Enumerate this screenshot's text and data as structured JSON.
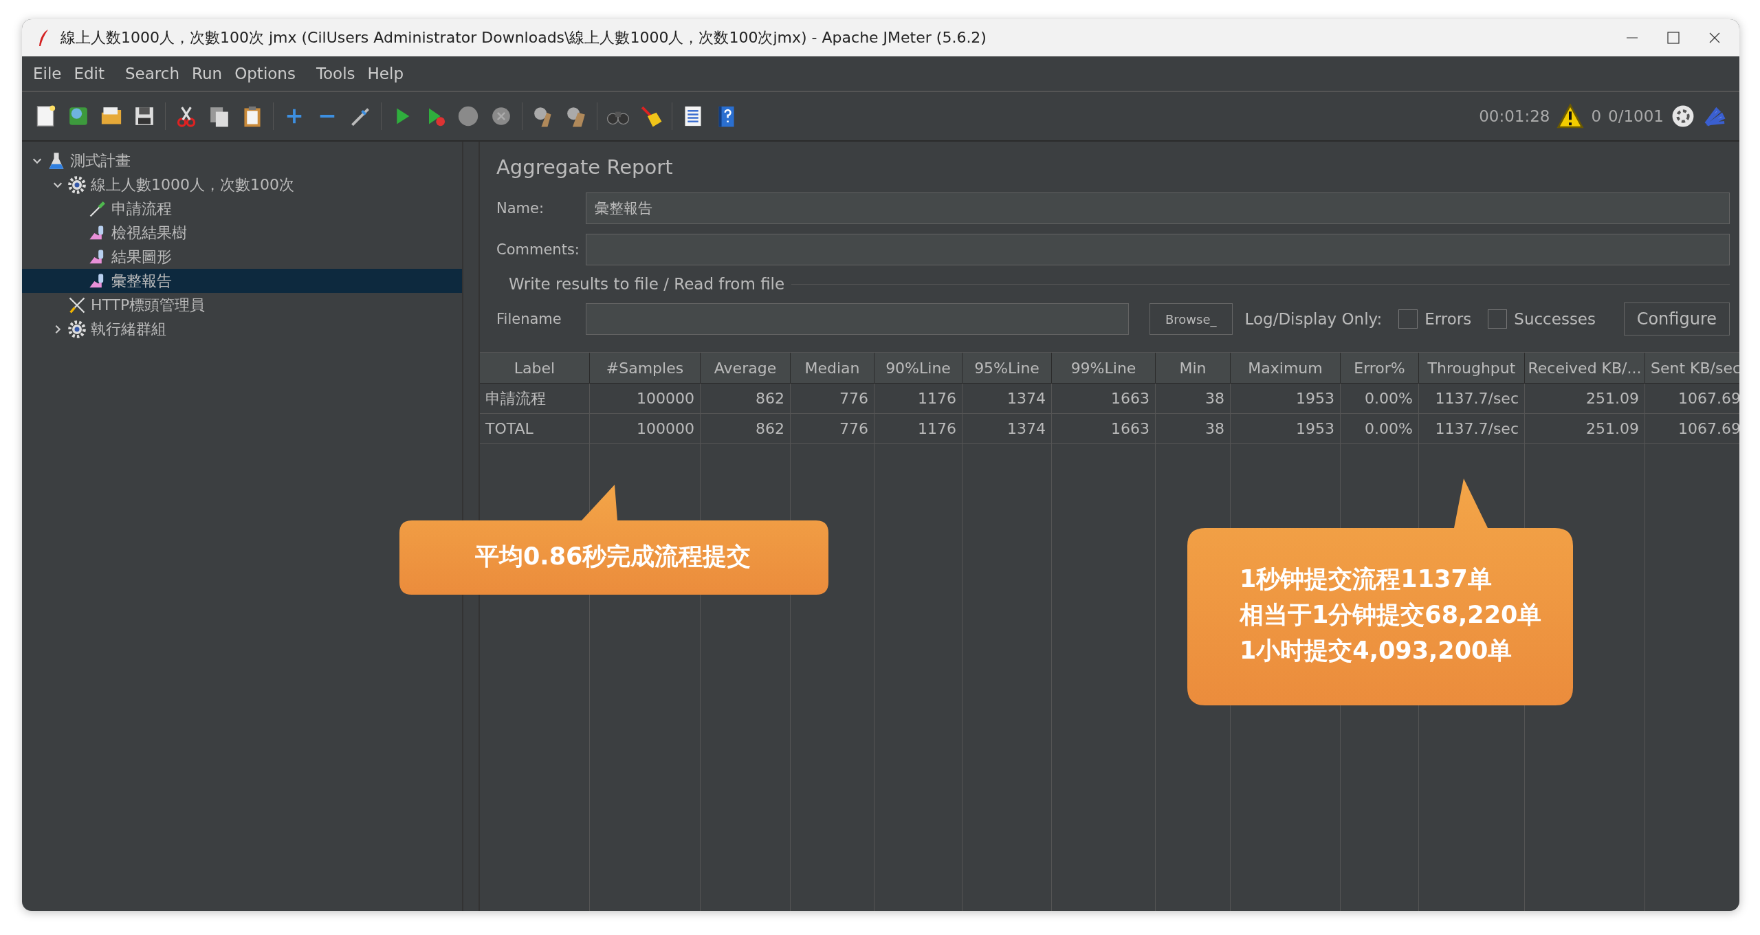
{
  "window": {
    "title": "線上人数1000人，次數100次 jmx (CilUsers Administrator Downloads\\線上人數1000人，次数100次jmx) - Apache JMeter (5.6.2)"
  },
  "menu": [
    "Eile",
    "Edit",
    "Search",
    "Run",
    "Options",
    "Tools",
    "Help"
  ],
  "status": {
    "elapsed": "00:01:28",
    "warnings": "0",
    "threads": "0/1001"
  },
  "tree": [
    {
      "label": "測式計畫",
      "kind": "plan",
      "expanded": true,
      "selected": false,
      "children": [
        {
          "label": "線上人數1000人，次數100次",
          "kind": "thread-group",
          "expanded": true,
          "selected": false,
          "children": [
            {
              "label": "申請流程",
              "kind": "sampler",
              "selected": false
            },
            {
              "label": "檢視結果樹",
              "kind": "listener",
              "selected": false
            },
            {
              "label": "結果圖形",
              "kind": "listener",
              "selected": false
            },
            {
              "label": "彙整報告",
              "kind": "listener",
              "selected": true
            }
          ]
        },
        {
          "label": "HTTP標頭管理員",
          "kind": "config",
          "selected": false
        },
        {
          "label": "執行緒群組",
          "kind": "thread-group",
          "expanded": false,
          "selected": false
        }
      ]
    }
  ],
  "panel": {
    "title": "Aggregate Report",
    "name_label": "Name:",
    "name_value": "彙整報告",
    "comments_label": "Comments:",
    "file_section": "Write results to file / Read from file",
    "filename_label": "Filename",
    "browse": "Browse_",
    "log_label": "Log/Display Only:",
    "errors": {
      "label": "Errors",
      "checked": false
    },
    "successes": {
      "label": "Successes",
      "checked": false
    },
    "configure": "Configure"
  },
  "table": {
    "columns": [
      "Label",
      "#Samples",
      "Average",
      "Median",
      "90%Line",
      "95%Line",
      "99%Line",
      "Min",
      "Maximum",
      "Error%",
      "Throughput",
      "Received KB/...",
      "Sent KB/sec"
    ],
    "rows": [
      [
        "申請流程",
        "100000",
        "862",
        "776",
        "1176",
        "1374",
        "1663",
        "38",
        "1953",
        "0.00%",
        "1137.7/sec",
        "251.09",
        "1067.69"
      ],
      [
        "TOTAL",
        "100000",
        "862",
        "776",
        "1176",
        "1374",
        "1663",
        "38",
        "1953",
        "0.00%",
        "1137.7/sec",
        "251.09",
        "1067.69"
      ]
    ]
  },
  "callouts": [
    {
      "lines": [
        "平均0.86秒完成流程提交"
      ]
    },
    {
      "lines": [
        "1秒钟提交流程1137单",
        "相当于1分钟提交68,220单",
        "1小时提交4,093,200单"
      ]
    }
  ]
}
